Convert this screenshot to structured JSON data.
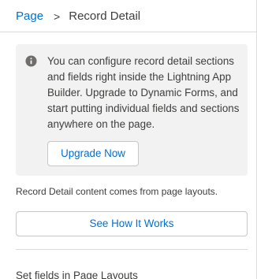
{
  "breadcrumb": {
    "parent": "Page",
    "separator": ">",
    "current": "Record Detail"
  },
  "info": {
    "icon": "info-icon",
    "message": "You can configure record detail sections and fields right inside the Lightning App Builder. Upgrade to Dynamic Forms, and start putting individual fields and sections anywhere on the page.",
    "upgrade_label": "Upgrade Now"
  },
  "content_note": "Record Detail content comes from page layouts.",
  "see_how_label": "See How It Works",
  "next_section_label": "Set fields in Page Layouts",
  "colors": {
    "link": "#0070d2",
    "text": "#3e3e3c",
    "info_bg": "#f3f2f2",
    "border": "#dddbda",
    "icon": "#706e6b"
  }
}
